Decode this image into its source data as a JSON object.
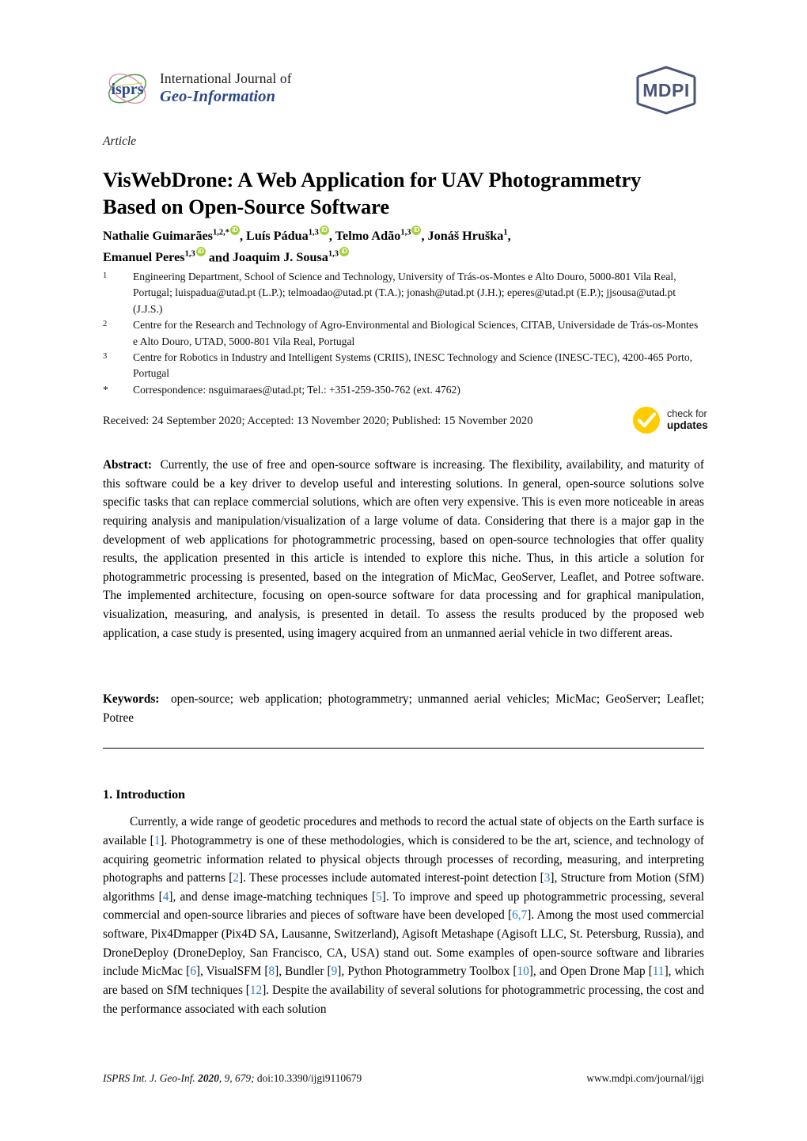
{
  "masthead": {
    "logo_icon": "isprs-logo",
    "journal_line1": "International Journal of",
    "journal_line2": "Geo-Information",
    "publisher_logo": "mdpi-logo",
    "publisher_name": "MDPI"
  },
  "article": {
    "type": "Article",
    "title": "VisWebDrone: A Web Application for UAV Photogrammetry Based on Open-Source Software"
  },
  "authors": {
    "line1_parts": [
      {
        "name": "Nathalie Guimarães",
        "sup": "1,2,*",
        "orcid": true,
        "sep": ", "
      },
      {
        "name": "Luís Pádua",
        "sup": "1,3",
        "orcid": true,
        "sep": ", "
      },
      {
        "name": "Telmo Adão",
        "sup": "1,3",
        "orcid": true,
        "sep": ", "
      },
      {
        "name": "Jonáš Hruška",
        "sup": "1",
        "orcid": false,
        "sep": ","
      }
    ],
    "line2_parts": [
      {
        "name": "Emanuel Peres",
        "sup": "1,3",
        "orcid": true,
        "sep": " and "
      },
      {
        "name": "Joaquim J. Sousa",
        "sup": "1,3",
        "orcid": true,
        "sep": ""
      }
    ],
    "orcid_icon": "orcid-icon"
  },
  "affiliations": [
    {
      "marker": "1",
      "text": "Engineering Department, School of Science and Technology, University of Trás-os-Montes e Alto Douro, 5000-801 Vila Real, Portugal; luispadua@utad.pt (L.P.); telmoadao@utad.pt (T.A.); jonash@utad.pt (J.H.); eperes@utad.pt (E.P.); jjsousa@utad.pt (J.J.S.)"
    },
    {
      "marker": "2",
      "text": "Centre for the Research and Technology of Agro-Environmental and Biological Sciences, CITAB, Universidade de Trás-os-Montes e Alto Douro, UTAD, 5000-801 Vila Real, Portugal"
    },
    {
      "marker": "3",
      "text": "Centre for Robotics in Industry and Intelligent Systems (CRIIS), INESC Technology and Science (INESC-TEC), 4200-465 Porto, Portugal"
    },
    {
      "marker": "*",
      "text": "Correspondence: nsguimaraes@utad.pt; Tel.: +351-259-350-762 (ext. 4762)"
    }
  ],
  "publication_dates": "Received: 24 September 2020; Accepted: 13 November 2020; Published: 15 November 2020",
  "updates_badge": {
    "icon": "check-circle-icon",
    "line1": "check for",
    "line2": "updates"
  },
  "abstract": {
    "label": "Abstract:",
    "text": "Currently, the use of free and open-source software is increasing.  The flexibility, availability, and maturity of this software could be a key driver to develop useful and interesting solutions. In general, open-source solutions solve specific tasks that can replace commercial solutions, which are often very expensive.  This is even more noticeable in areas requiring analysis and manipulation/visualization of a large volume of data. Considering that there is a major gap in the development of web applications for photogrammetric processing, based on open-source technologies that offer quality results, the application presented in this article is intended to explore this niche. Thus, in this article a solution for photogrammetric processing is presented, based on the integration of MicMac, GeoServer, Leaflet, and Potree software.  The implemented architecture, focusing on open-source software for data processing and for graphical manipulation, visualization, measuring, and analysis, is presented in detail. To assess the results produced by the proposed web application, a case study is presented, using imagery acquired from an unmanned aerial vehicle in two different areas."
  },
  "keywords": {
    "label": "Keywords:",
    "text": "open-source; web application; photogrammetry; unmanned aerial vehicles; MicMac; GeoServer; Leaflet; Potree"
  },
  "section": {
    "heading": "1. Introduction",
    "paragraph_segments": [
      {
        "t": "Currently, a wide range of geodetic procedures and methods to record the actual state of objects on the Earth surface is available ["
      },
      {
        "c": "1"
      },
      {
        "t": "].  Photogrammetry is one of these methodologies, which is considered to be the art, science, and technology of acquiring geometric information related to physical objects through processes of recording, measuring, and interpreting photographs and patterns ["
      },
      {
        "c": "2"
      },
      {
        "t": "].  These processes include automated interest-point detection ["
      },
      {
        "c": "3"
      },
      {
        "t": "], Structure from Motion (SfM) algorithms ["
      },
      {
        "c": "4"
      },
      {
        "t": "], and dense image-matching techniques ["
      },
      {
        "c": "5"
      },
      {
        "t": "]. To improve and speed up photogrammetric processing, several commercial and open-source libraries and pieces of software have been developed ["
      },
      {
        "c": "6,7"
      },
      {
        "t": "].  Among the most used commercial software, Pix4Dmapper (Pix4D SA, Lausanne, Switzerland), Agisoft Metashape (Agisoft LLC, St. Petersburg, Russia), and DroneDeploy (DroneDeploy, San Francisco, CA, USA) stand out.  Some examples of open-source software and libraries include MicMac ["
      },
      {
        "c": "6"
      },
      {
        "t": "], VisualSFM ["
      },
      {
        "c": "8"
      },
      {
        "t": "], Bundler ["
      },
      {
        "c": "9"
      },
      {
        "t": "], Python Photogrammetry Toolbox ["
      },
      {
        "c": "10"
      },
      {
        "t": "], and Open Drone Map ["
      },
      {
        "c": "11"
      },
      {
        "t": "], which are based on SfM techniques ["
      },
      {
        "c": "12"
      },
      {
        "t": "]. Despite the availability of several solutions for photogrammetric processing, the cost and the performance associated with each solution"
      }
    ]
  },
  "footer": {
    "journal_abbrev": "ISPRS Int. J. Geo-Inf.",
    "year": "2020",
    "volume_issue": ", 9, 679; ",
    "doi": "doi:10.3390/ijgi9110679",
    "url": "www.mdpi.com/journal/ijgi"
  },
  "colors": {
    "journal_blue": "#2b4a8b",
    "citation_blue": "#2b7fc4",
    "orcid_green": "#a6ce39",
    "badge_yellow": "#ffcc00",
    "mdpi_navy": "#4a5578"
  }
}
